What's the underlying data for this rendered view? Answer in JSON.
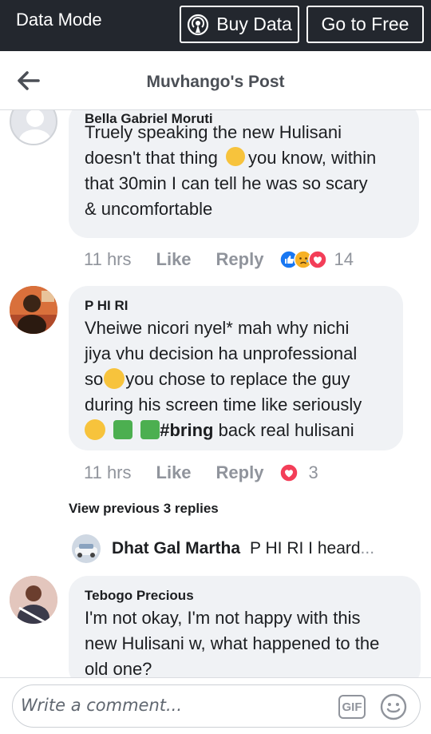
{
  "topbar": {
    "mode_label": "Data Mode",
    "buy_label": "Buy Data",
    "free_label": "Go to Free"
  },
  "header": {
    "title": "Muvhango's Post"
  },
  "comments": [
    {
      "author": "Bella Gabriel Moruti",
      "lines": [
        "Truely speaking the new Hulisani",
        "doesn't that thing",
        "you know, within",
        "that 30min I can tell he was so scary",
        "& uncomfortable"
      ],
      "time": "11 hrs",
      "like": "Like",
      "reply": "Reply",
      "reactions": [
        "like",
        "sad",
        "love"
      ],
      "reaction_count": "14"
    },
    {
      "author": "P HI RI",
      "lines": [
        "Vheiwe nicori nyel* mah why nichi",
        "jiya vhu decision ha unprofessional",
        "so",
        "you chose to replace the guy",
        "during his screen time like seriously",
        "#bring",
        "back real hulisani"
      ],
      "time": "11 hrs",
      "like": "Like",
      "reply": "Reply",
      "reactions": [
        "love"
      ],
      "reaction_count": "3"
    },
    {
      "author": "Tebogo Precious",
      "lines": [
        "I'm not okay, I'm not happy with this",
        "new Hulisani w, what happened to the",
        "old one?"
      ]
    }
  ],
  "replies": {
    "view_previous": "View previous 3 replies",
    "author": "Dhat Gal Martha",
    "snippet": "P HI RI I heard",
    "ellipsis": "..."
  },
  "composer": {
    "placeholder": "Write a comment...",
    "gif_label": "GIF"
  },
  "colors": {
    "topbar": "#23272e",
    "bubble": "#f0f2f5",
    "like_blue": "#1877f2",
    "love_red": "#f33e58",
    "sad_yellow": "#f7b125"
  }
}
